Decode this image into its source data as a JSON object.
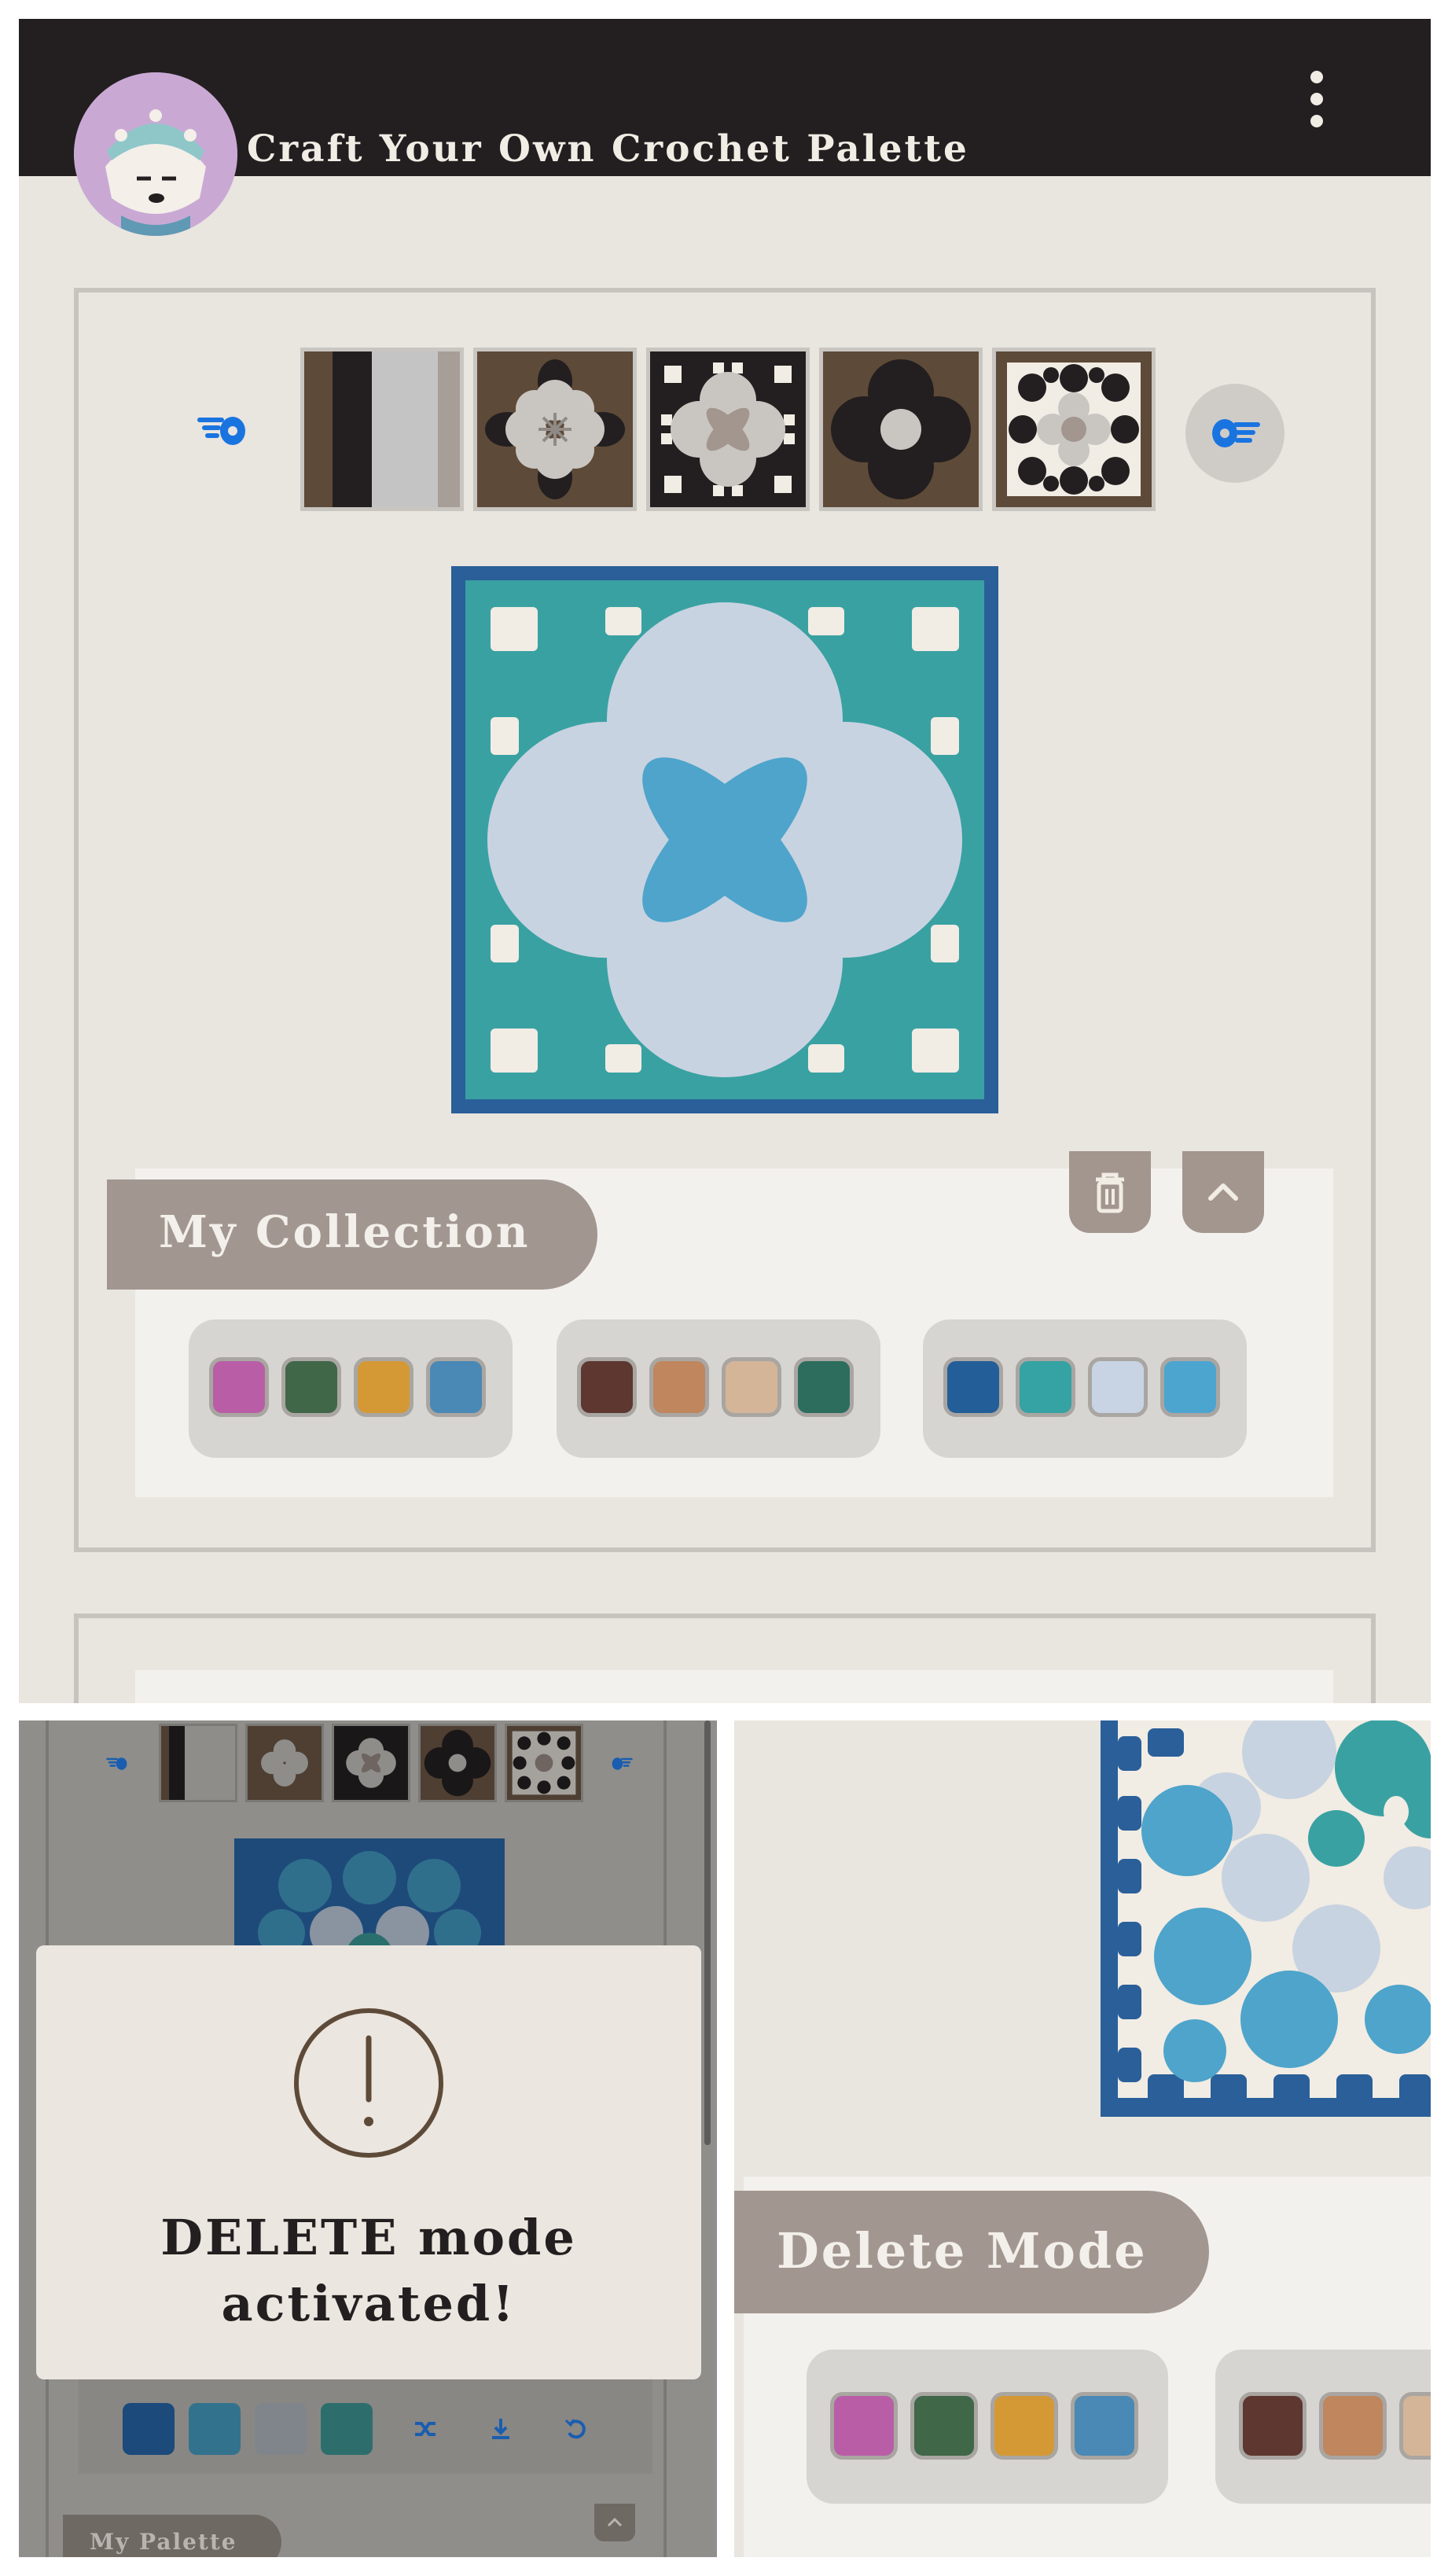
{
  "app": {
    "title": "Craft Your Own Crochet Palette",
    "avatar_icon": "deer-avatar-icon",
    "menu_icon": "kebab-menu-icon"
  },
  "nav": {
    "prev_icon": "point-left-hand-icon",
    "next_icon": "point-right-hand-icon"
  },
  "patterns": [
    {
      "name": "stripes-pattern"
    },
    {
      "name": "flower-granny-pattern"
    },
    {
      "name": "x-flower-pattern"
    },
    {
      "name": "big-flower-pattern"
    },
    {
      "name": "classic-granny-pattern"
    }
  ],
  "preview": {
    "colors": [
      "#2a5f99",
      "#3aa1a2",
      "#c8d3e1",
      "#4ea4cb"
    ]
  },
  "collection": {
    "label": "My Collection",
    "delete_icon": "trash-icon",
    "collapse_icon": "chevron-up-icon",
    "palettes": [
      {
        "colors": [
          "#b95ea6",
          "#3f6748",
          "#d49935",
          "#4a88b5"
        ]
      },
      {
        "colors": [
          "#5d3730",
          "#c0865e",
          "#d4b598",
          "#2d6d5e"
        ]
      },
      {
        "colors": [
          "#235e99",
          "#35a2a3",
          "#c8d4e3",
          "#4ca5cf"
        ]
      }
    ]
  },
  "dialog": {
    "icon": "exclamation-circle-icon",
    "message_line1": "DELETE mode",
    "message_line2": "activated!"
  },
  "mini_palette": {
    "colors": [
      "#1c4a7b",
      "#33728d",
      "#7f858a",
      "#2d6e6d"
    ],
    "shuffle_icon": "shuffle-icon",
    "download_icon": "download-icon",
    "reset_icon": "undo-icon",
    "label": "My Palette"
  },
  "delete_mode": {
    "label": "Delete Mode",
    "palettes": [
      {
        "colors": [
          "#b95ea6",
          "#3f6748",
          "#d49935",
          "#4a88b5"
        ]
      },
      {
        "colors": [
          "#5d3730",
          "#c0865e",
          "#d4b598"
        ]
      }
    ]
  }
}
